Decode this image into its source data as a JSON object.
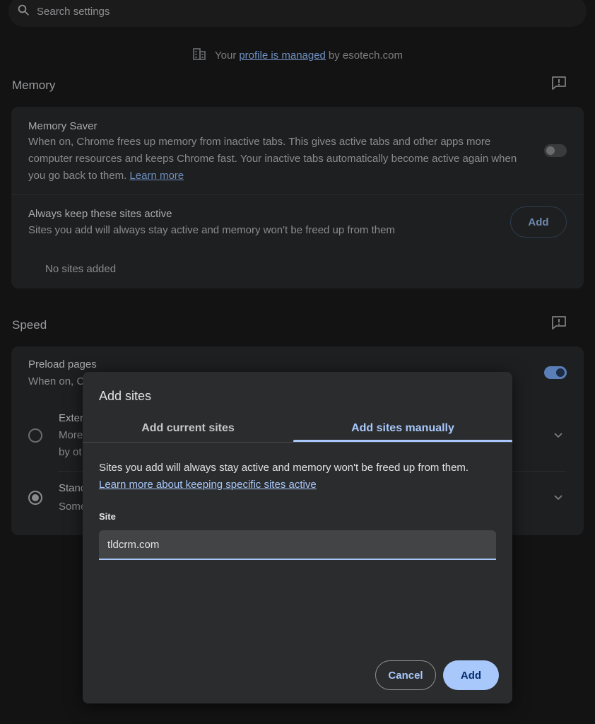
{
  "search": {
    "placeholder": "Search settings"
  },
  "managed": {
    "prefix": "Your",
    "link": "profile is managed",
    "suffix": "by esotech.com"
  },
  "memory": {
    "title": "Memory",
    "memory_saver": {
      "title": "Memory Saver",
      "description": "When on, Chrome frees up memory from inactive tabs. This gives active tabs and other apps more computer resources and keeps Chrome fast. Your inactive tabs automatically become active again when you go back to them.",
      "learn_more": "Learn more",
      "enabled": false
    },
    "always_active": {
      "title": "Always keep these sites active",
      "description": "Sites you add will always stay active and memory won't be freed up from them",
      "add_label": "Add",
      "empty_text": "No sites added"
    }
  },
  "speed": {
    "title": "Speed",
    "preload": {
      "title": "Preload pages",
      "description_partial": "When on, C",
      "enabled": true
    },
    "options": [
      {
        "title_partial": "Exter",
        "desc_line1": "More",
        "desc_line2": "by ot",
        "selected": false
      },
      {
        "title_partial": "Stanc",
        "desc_line1": "Some",
        "selected": true
      }
    ]
  },
  "dialog": {
    "title": "Add sites",
    "tabs": [
      {
        "label": "Add current sites",
        "active": false
      },
      {
        "label": "Add sites manually",
        "active": true
      }
    ],
    "description": "Sites you add will always stay active and memory won't be freed up from them.",
    "learn_more": "Learn more about keeping specific sites active",
    "field_label": "Site",
    "field_value": "tldcrm.com",
    "cancel_label": "Cancel",
    "add_label": "Add"
  },
  "colors": {
    "accent": "#a8c7fa",
    "dialog_bg": "#2b2c2e",
    "page_bg": "#131314"
  }
}
